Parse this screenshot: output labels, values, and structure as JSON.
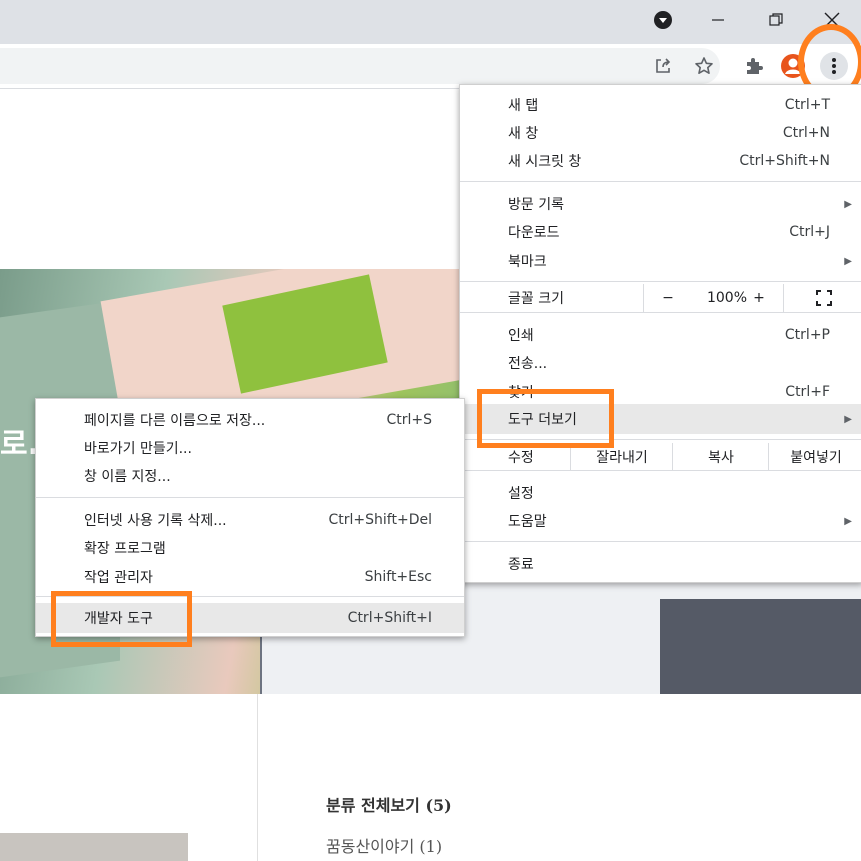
{
  "menu": {
    "new_tab": {
      "label": "새 탭",
      "shortcut": "Ctrl+T"
    },
    "new_window": {
      "label": "새 창",
      "shortcut": "Ctrl+N"
    },
    "incognito": {
      "label": "새 시크릿 창",
      "shortcut": "Ctrl+Shift+N"
    },
    "history": {
      "label": "방문 기록"
    },
    "downloads": {
      "label": "다운로드",
      "shortcut": "Ctrl+J"
    },
    "bookmarks": {
      "label": "북마크"
    },
    "zoom": {
      "label": "글꼴 크기",
      "minus": "−",
      "value": "100%",
      "plus": "+"
    },
    "print": {
      "label": "인쇄",
      "shortcut": "Ctrl+P"
    },
    "cast": {
      "label": "전송..."
    },
    "find": {
      "label": "찾기",
      "shortcut": "Ctrl+F"
    },
    "more_tools": {
      "label": "도구 더보기"
    },
    "edit": {
      "label": "수정",
      "cut": "잘라내기",
      "copy": "복사",
      "paste": "붙여넣기"
    },
    "settings": {
      "label": "설정"
    },
    "help": {
      "label": "도움말"
    },
    "exit": {
      "label": "종료"
    }
  },
  "submenu": {
    "save_as": {
      "label": "페이지를 다른 이름으로 저장...",
      "shortcut": "Ctrl+S"
    },
    "shortcut": {
      "label": "바로가기 만들기..."
    },
    "name_window": {
      "label": "창 이름 지정..."
    },
    "clear_data": {
      "label": "인터넷 사용 기록 삭제...",
      "shortcut": "Ctrl+Shift+Del"
    },
    "extensions": {
      "label": "확장 프로그램"
    },
    "task_manager": {
      "label": "작업 관리자",
      "shortcut": "Shift+Esc"
    },
    "devtools": {
      "label": "개발자 도구",
      "shortcut": "Ctrl+Shift+I"
    }
  },
  "page": {
    "banner_text": "로..",
    "category_all": "분류 전체보기 (5)",
    "category_1": "꿈동산이야기 (1)"
  },
  "icons": [
    "tab-search-icon",
    "minimize-icon",
    "restore-icon",
    "close-icon",
    "share-icon",
    "star-icon",
    "extensions-icon",
    "profile-icon",
    "more-menu-icon",
    "fullscreen-icon"
  ],
  "colors": {
    "highlight": "#ff7f1e",
    "profile": "#e8541c"
  }
}
